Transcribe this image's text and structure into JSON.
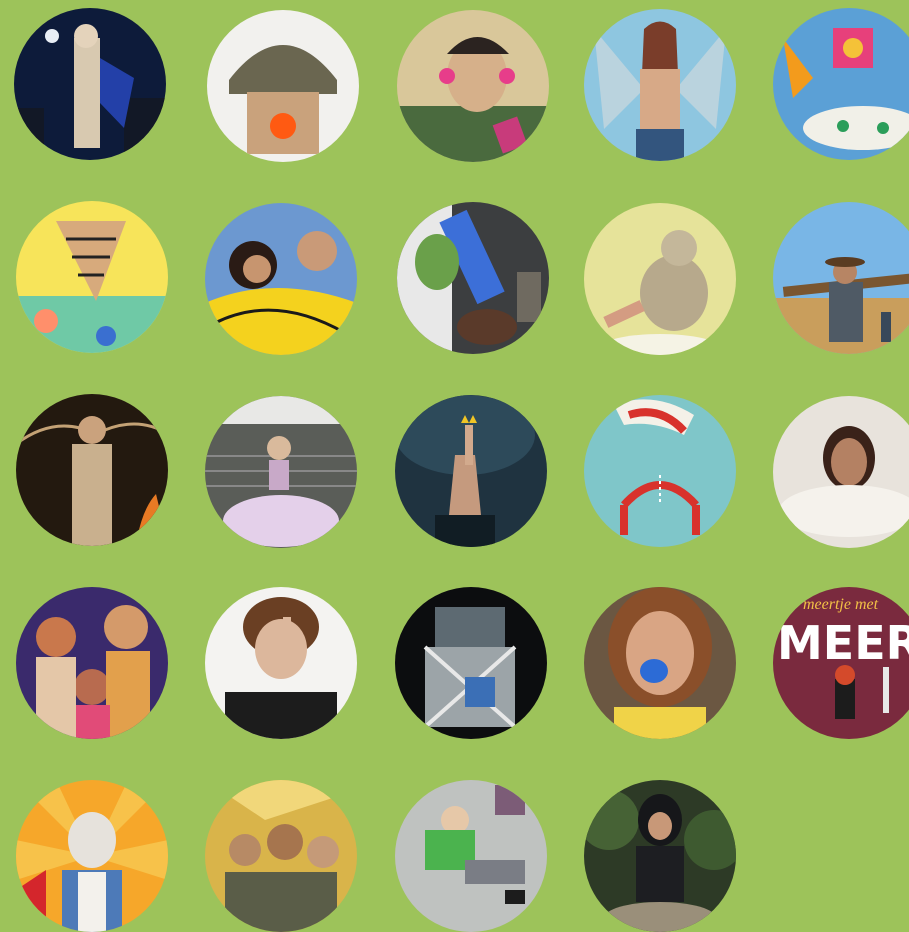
{
  "page": {
    "background": "#9dc35a"
  },
  "tiles": [
    {
      "name": "tile-night-city-hero",
      "icon": "photo-icon"
    },
    {
      "name": "tile-clown-helmet",
      "icon": "photo-icon"
    },
    {
      "name": "tile-headphones-man",
      "icon": "photo-icon"
    },
    {
      "name": "tile-winged-woman",
      "icon": "photo-icon"
    },
    {
      "name": "tile-child-drawing",
      "icon": "drawing-icon"
    },
    {
      "name": "tile-tornado-drawing",
      "icon": "drawing-icon"
    },
    {
      "name": "tile-couple-yellow",
      "icon": "photo-icon"
    },
    {
      "name": "tile-dancers-blue",
      "icon": "photo-icon"
    },
    {
      "name": "tile-stone-animal",
      "icon": "photo-icon"
    },
    {
      "name": "tile-cowboy-field",
      "icon": "photo-icon"
    },
    {
      "name": "tile-fire-man",
      "icon": "photo-icon"
    },
    {
      "name": "tile-princess-stairs",
      "icon": "photo-icon"
    },
    {
      "name": "tile-hand-crown",
      "icon": "photo-icon"
    },
    {
      "name": "tile-acrobat-illustration",
      "icon": "illustration-icon"
    },
    {
      "name": "tile-girl-sand",
      "icon": "photo-icon"
    },
    {
      "name": "tile-singers-stage",
      "icon": "photo-icon"
    },
    {
      "name": "tile-boy-finger",
      "icon": "photo-icon"
    },
    {
      "name": "tile-junk-sculpture",
      "icon": "photo-icon"
    },
    {
      "name": "tile-woman-blue-mouth",
      "icon": "photo-icon"
    },
    {
      "name": "tile-meer-poster",
      "icon": "poster-icon",
      "text": "MEER",
      "subtext": "meertje met"
    },
    {
      "name": "tile-circus-puppet",
      "icon": "illustration-icon"
    },
    {
      "name": "tile-gold-crowd",
      "icon": "photo-icon"
    },
    {
      "name": "tile-green-sweater-floor",
      "icon": "photo-icon"
    },
    {
      "name": "tile-dark-hair-girl",
      "icon": "photo-icon"
    }
  ]
}
